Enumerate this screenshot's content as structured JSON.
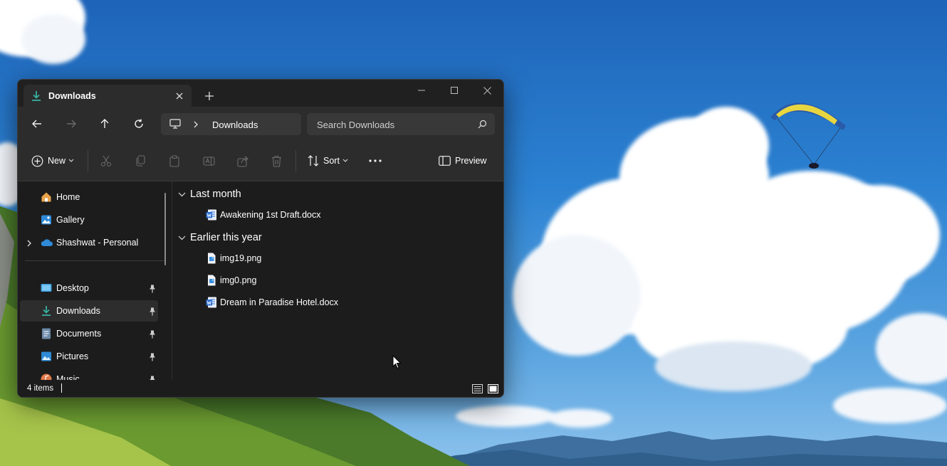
{
  "window": {
    "tab_title": "Downloads",
    "tab_icon": "download-icon"
  },
  "navbar": {
    "breadcrumb": "Downloads",
    "search_placeholder": "Search Downloads"
  },
  "toolbar": {
    "new_label": "New",
    "sort_label": "Sort",
    "preview_label": "Preview"
  },
  "sidebar": {
    "items": [
      {
        "label": "Home",
        "icon": "home-icon"
      },
      {
        "label": "Gallery",
        "icon": "gallery-icon"
      },
      {
        "label": "Shashwat - Personal",
        "icon": "onedrive-cloud-icon"
      },
      {
        "label": "Desktop",
        "icon": "desktop-folder-icon",
        "pinned": true
      },
      {
        "label": "Downloads",
        "icon": "downloads-folder-icon",
        "pinned": true,
        "selected": true
      },
      {
        "label": "Documents",
        "icon": "documents-folder-icon",
        "pinned": true
      },
      {
        "label": "Pictures",
        "icon": "pictures-folder-icon",
        "pinned": true
      },
      {
        "label": "Music",
        "icon": "music-folder-icon",
        "pinned": true
      }
    ]
  },
  "content": {
    "groups": [
      {
        "label": "Last month",
        "files": [
          {
            "name": "Awakening 1st Draft.docx",
            "icon": "word-document-icon"
          }
        ]
      },
      {
        "label": "Earlier this year",
        "files": [
          {
            "name": "img19.png",
            "icon": "image-file-icon"
          },
          {
            "name": "img0.png",
            "icon": "image-file-icon"
          },
          {
            "name": "Dream in Paradise Hotel.docx",
            "icon": "word-document-icon"
          }
        ]
      }
    ]
  },
  "statusbar": {
    "item_count": "4 items"
  },
  "colors": {
    "window_bg": "#1c1c1c",
    "chrome_bg": "#2c2c2c",
    "accent_download": "#37b0a0",
    "word_blue": "#2b6fd4"
  }
}
